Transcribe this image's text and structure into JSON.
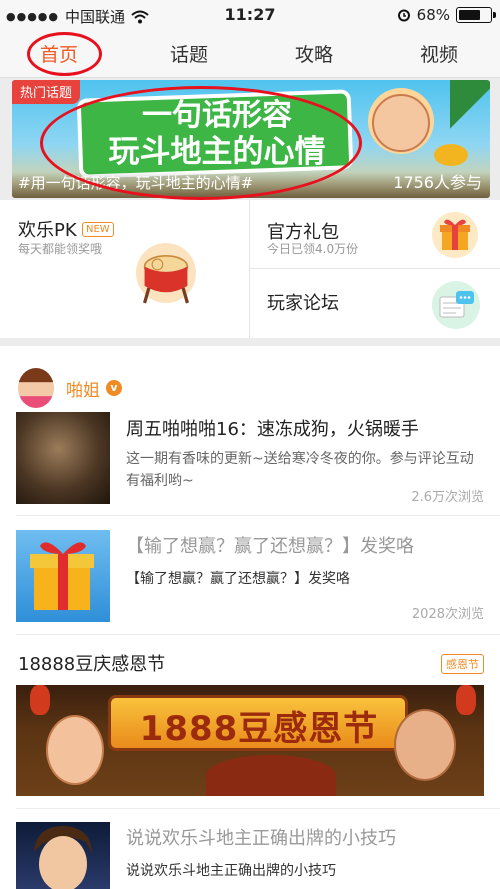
{
  "status_bar": {
    "carrier": "中国联通",
    "time": "11:27",
    "battery_text": "68%",
    "battery_level": 0.68,
    "icons": [
      "signal-dots-icon",
      "wifi-icon",
      "alarm-icon",
      "battery-icon"
    ]
  },
  "tabs": [
    {
      "label": "首页",
      "active": true
    },
    {
      "label": "话题",
      "active": false
    },
    {
      "label": "攻略",
      "active": false
    },
    {
      "label": "视频",
      "active": false
    }
  ],
  "banner": {
    "tag": "热门话题",
    "headline_line1": "一句话形容",
    "headline_line2": "玩斗地主的心情",
    "hashtag": "#用一句话形容，玩斗地主的心情#",
    "participants": "1756人参与"
  },
  "quick_entries": {
    "pk": {
      "title": "欢乐PK",
      "badge": "NEW",
      "subtitle": "每天都能领奖哦"
    },
    "gift": {
      "title": "官方礼包",
      "subtitle": "今日已领4.0万份"
    },
    "forum": {
      "title": "玩家论坛"
    }
  },
  "feed": {
    "author": {
      "name": "啪姐",
      "badge": "v"
    },
    "articles": [
      {
        "title": "周五啪啪啪16：速冻成狗，火锅暖手",
        "desc": "这一期有香味的更新~送给寒冷冬夜的你。参与评论互动有福利哟~",
        "views": "2.6万次浏览"
      },
      {
        "title": "【输了想赢？赢了还想赢？】发奖咯",
        "desc": "【输了想赢？赢了还想赢？】发奖咯",
        "views": "2028次浏览"
      },
      {
        "title": "说说欢乐斗地主正确出牌的小技巧",
        "desc": "说说欢乐斗地主正确出牌的小技巧"
      }
    ],
    "section": {
      "title": "18888豆庆感恩节",
      "tag": "感恩节",
      "banner_text": "1888豆感恩节"
    }
  },
  "colors": {
    "accent": "#f15a24",
    "annotation_red": "#e8101d",
    "badge_orange": "#f08a24"
  }
}
